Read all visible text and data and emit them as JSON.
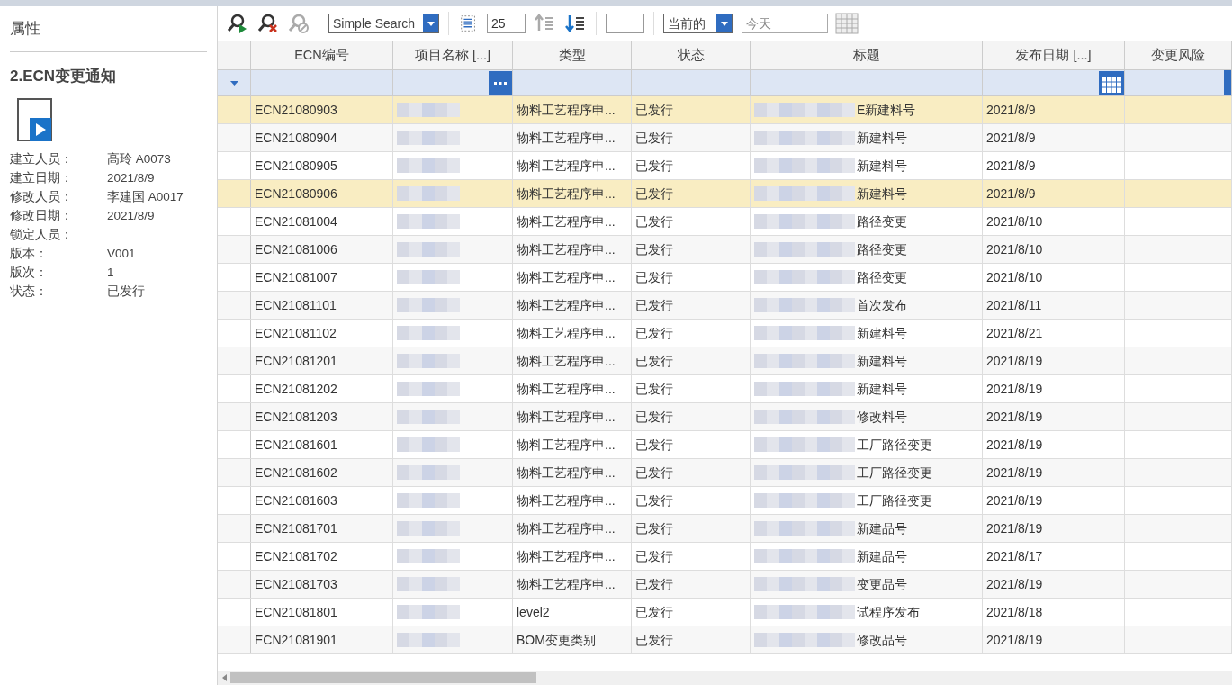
{
  "sidebar": {
    "heading": "属性",
    "title": "2.ECN变更通知",
    "properties": [
      {
        "label": "建立人员：",
        "value": "高玲 A0073"
      },
      {
        "label": "建立日期：",
        "value": "2021/8/9"
      },
      {
        "label": "修改人员：",
        "value": "李建国 A0017"
      },
      {
        "label": "修改日期：",
        "value": "2021/8/9"
      },
      {
        "label": "锁定人员："
      },
      {
        "label": "版本：",
        "value": "V001"
      },
      {
        "label": "版次：",
        "value": "1"
      },
      {
        "label": "状态：",
        "value": "已发行"
      }
    ]
  },
  "toolbar": {
    "search_mode": "Simple Search",
    "page_size": "25",
    "scope": "当前的",
    "date_placeholder": "今天"
  },
  "table": {
    "columns": [
      "ECN编号",
      "项目名称 [...]",
      "类型",
      "状态",
      "标题",
      "发布日期 [...]",
      "变更风险"
    ],
    "rows": [
      {
        "selected": true,
        "ecn": "ECN21080903",
        "type": "物料工艺程序申...",
        "status": "已发行",
        "title": "E新建料号",
        "date": "2021/8/9"
      },
      {
        "selected": false,
        "ecn": "ECN21080904",
        "type": "物料工艺程序申...",
        "status": "已发行",
        "title": "新建料号",
        "date": "2021/8/9"
      },
      {
        "selected": false,
        "ecn": "ECN21080905",
        "type": "物料工艺程序申...",
        "status": "已发行",
        "title": "新建料号",
        "date": "2021/8/9"
      },
      {
        "selected": true,
        "ecn": "ECN21080906",
        "type": "物料工艺程序申...",
        "status": "已发行",
        "title": "新建料号",
        "date": "2021/8/9"
      },
      {
        "selected": false,
        "ecn": "ECN21081004",
        "type": "物料工艺程序申...",
        "status": "已发行",
        "title": "路径变更",
        "date": "2021/8/10"
      },
      {
        "selected": false,
        "ecn": "ECN21081006",
        "type": "物料工艺程序申...",
        "status": "已发行",
        "title": "路径变更",
        "date": "2021/8/10"
      },
      {
        "selected": false,
        "ecn": "ECN21081007",
        "type": "物料工艺程序申...",
        "status": "已发行",
        "title": "路径变更",
        "date": "2021/8/10"
      },
      {
        "selected": false,
        "ecn": "ECN21081101",
        "type": "物料工艺程序申...",
        "status": "已发行",
        "title": "首次发布",
        "date": "2021/8/11"
      },
      {
        "selected": false,
        "ecn": "ECN21081102",
        "type": "物料工艺程序申...",
        "status": "已发行",
        "title": "新建料号",
        "date": "2021/8/21"
      },
      {
        "selected": false,
        "ecn": "ECN21081201",
        "type": "物料工艺程序申...",
        "status": "已发行",
        "title": "新建料号",
        "date": "2021/8/19"
      },
      {
        "selected": false,
        "ecn": "ECN21081202",
        "type": "物料工艺程序申...",
        "status": "已发行",
        "title": "新建料号",
        "date": "2021/8/19"
      },
      {
        "selected": false,
        "ecn": "ECN21081203",
        "type": "物料工艺程序申...",
        "status": "已发行",
        "title": "修改料号",
        "date": "2021/8/19"
      },
      {
        "selected": false,
        "ecn": "ECN21081601",
        "type": "物料工艺程序申...",
        "status": "已发行",
        "title": "工厂路径变更",
        "date": "2021/8/19"
      },
      {
        "selected": false,
        "ecn": "ECN21081602",
        "type": "物料工艺程序申...",
        "status": "已发行",
        "title": "工厂路径变更",
        "date": "2021/8/19"
      },
      {
        "selected": false,
        "ecn": "ECN21081603",
        "type": "物料工艺程序申...",
        "status": "已发行",
        "title": "工厂路径变更",
        "date": "2021/8/19"
      },
      {
        "selected": false,
        "ecn": "ECN21081701",
        "type": "物料工艺程序申...",
        "status": "已发行",
        "title": "新建品号",
        "date": "2021/8/19"
      },
      {
        "selected": false,
        "ecn": "ECN21081702",
        "type": "物料工艺程序申...",
        "status": "已发行",
        "title": "新建品号",
        "date": "2021/8/17"
      },
      {
        "selected": false,
        "ecn": "ECN21081703",
        "type": "物料工艺程序申...",
        "status": "已发行",
        "title": "变更品号",
        "date": "2021/8/19"
      },
      {
        "selected": false,
        "ecn": "ECN21081801",
        "type": "level2",
        "status": "已发行",
        "title": "试程序发布",
        "date": "2021/8/18"
      },
      {
        "selected": false,
        "ecn": "ECN21081901",
        "type": "BOM变更类别",
        "status": "已发行",
        "title": "修改品号",
        "date": "2021/8/19"
      }
    ]
  }
}
